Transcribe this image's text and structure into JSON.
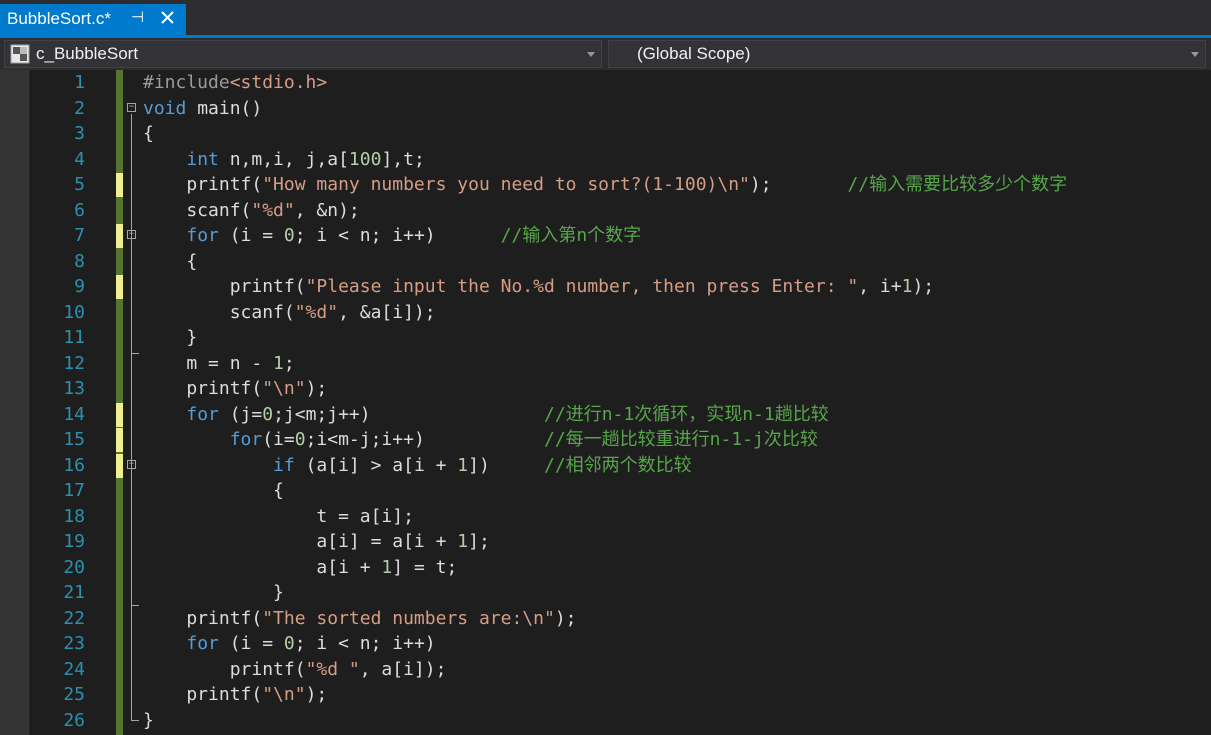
{
  "tab": {
    "title": "BubbleSort.c*"
  },
  "navbar": {
    "project": "c_BubbleSort",
    "scope": "(Global Scope)"
  },
  "colors": {
    "accent": "#007acc",
    "keyword": "#569cd6",
    "string": "#d69d85",
    "comment": "#57a64a",
    "line_number": "#2b91af",
    "number": "#b5cea8"
  },
  "icons": {
    "pin": "pin-icon",
    "close": "close-icon",
    "project": "c-project-icon"
  },
  "code": {
    "lines": [
      {
        "n": "1",
        "mod": false,
        "fold": null,
        "segs": [
          {
            "t": "#include",
            "c": "pp"
          },
          {
            "t": "<stdio.h>",
            "c": "str"
          }
        ]
      },
      {
        "n": "2",
        "mod": false,
        "fold": "open",
        "segs": [
          {
            "t": "void",
            "c": "kw"
          },
          {
            "t": " main()",
            "c": ""
          }
        ]
      },
      {
        "n": "3",
        "mod": false,
        "fold": null,
        "segs": [
          {
            "t": "{",
            "c": ""
          }
        ]
      },
      {
        "n": "4",
        "mod": false,
        "fold": null,
        "segs": [
          {
            "t": "    ",
            "c": ""
          },
          {
            "t": "int",
            "c": "kw"
          },
          {
            "t": " n,m,i, j,a[",
            "c": ""
          },
          {
            "t": "100",
            "c": "num"
          },
          {
            "t": "],t;",
            "c": ""
          }
        ]
      },
      {
        "n": "5",
        "mod": true,
        "fold": null,
        "segs": [
          {
            "t": "    printf(",
            "c": ""
          },
          {
            "t": "\"How many numbers you need to sort?(1-100)\\n\"",
            "c": "str"
          },
          {
            "t": ");       ",
            "c": ""
          },
          {
            "t": "//输入需要比较多少个数字",
            "c": "cm"
          }
        ]
      },
      {
        "n": "6",
        "mod": false,
        "fold": null,
        "segs": [
          {
            "t": "    scanf(",
            "c": ""
          },
          {
            "t": "\"%d\"",
            "c": "str"
          },
          {
            "t": ", &n);",
            "c": ""
          }
        ]
      },
      {
        "n": "7",
        "mod": true,
        "fold": "open",
        "segs": [
          {
            "t": "    ",
            "c": ""
          },
          {
            "t": "for",
            "c": "kw"
          },
          {
            "t": " (i = ",
            "c": ""
          },
          {
            "t": "0",
            "c": "num"
          },
          {
            "t": "; i < n; i++)      ",
            "c": ""
          },
          {
            "t": "//输入第n个数字",
            "c": "cm"
          }
        ]
      },
      {
        "n": "8",
        "mod": false,
        "fold": null,
        "segs": [
          {
            "t": "    {",
            "c": ""
          }
        ]
      },
      {
        "n": "9",
        "mod": true,
        "fold": null,
        "segs": [
          {
            "t": "        printf(",
            "c": ""
          },
          {
            "t": "\"Please input the No.%d number, then press Enter: \"",
            "c": "str"
          },
          {
            "t": ", i+",
            "c": ""
          },
          {
            "t": "1",
            "c": "num"
          },
          {
            "t": ");",
            "c": ""
          }
        ]
      },
      {
        "n": "10",
        "mod": false,
        "fold": null,
        "segs": [
          {
            "t": "        scanf(",
            "c": ""
          },
          {
            "t": "\"%d\"",
            "c": "str"
          },
          {
            "t": ", &a[i]);",
            "c": ""
          }
        ]
      },
      {
        "n": "11",
        "mod": false,
        "fold": null,
        "segs": [
          {
            "t": "    }",
            "c": ""
          }
        ]
      },
      {
        "n": "12",
        "mod": false,
        "fold": null,
        "segs": [
          {
            "t": "    m = n - ",
            "c": ""
          },
          {
            "t": "1",
            "c": "num"
          },
          {
            "t": ";",
            "c": ""
          }
        ]
      },
      {
        "n": "13",
        "mod": false,
        "fold": null,
        "segs": [
          {
            "t": "    printf(",
            "c": ""
          },
          {
            "t": "\"\\n\"",
            "c": "str"
          },
          {
            "t": ");",
            "c": ""
          }
        ]
      },
      {
        "n": "14",
        "mod": true,
        "fold": null,
        "segs": [
          {
            "t": "    ",
            "c": ""
          },
          {
            "t": "for",
            "c": "kw"
          },
          {
            "t": " (j=",
            "c": ""
          },
          {
            "t": "0",
            "c": "num"
          },
          {
            "t": ";j<m;j++)                ",
            "c": ""
          },
          {
            "t": "//进行n-1次循环，实现n-1趟比较",
            "c": "cm"
          }
        ]
      },
      {
        "n": "15",
        "mod": true,
        "fold": null,
        "segs": [
          {
            "t": "        ",
            "c": ""
          },
          {
            "t": "for",
            "c": "kw"
          },
          {
            "t": "(i=",
            "c": ""
          },
          {
            "t": "0",
            "c": "num"
          },
          {
            "t": ";i<m-j;i++)           ",
            "c": ""
          },
          {
            "t": "//每一趟比较重进行n-1-j次比较",
            "c": "cm"
          }
        ]
      },
      {
        "n": "16",
        "mod": true,
        "fold": "open",
        "segs": [
          {
            "t": "            ",
            "c": ""
          },
          {
            "t": "if",
            "c": "kw"
          },
          {
            "t": " (a[i] > a[i + ",
            "c": ""
          },
          {
            "t": "1",
            "c": "num"
          },
          {
            "t": "])     ",
            "c": ""
          },
          {
            "t": "//相邻两个数比较",
            "c": "cm"
          }
        ]
      },
      {
        "n": "17",
        "mod": false,
        "fold": null,
        "segs": [
          {
            "t": "            {",
            "c": ""
          }
        ]
      },
      {
        "n": "18",
        "mod": false,
        "fold": null,
        "segs": [
          {
            "t": "                t = a[i];",
            "c": ""
          }
        ]
      },
      {
        "n": "19",
        "mod": false,
        "fold": null,
        "segs": [
          {
            "t": "                a[i] = a[i + ",
            "c": ""
          },
          {
            "t": "1",
            "c": "num"
          },
          {
            "t": "];",
            "c": ""
          }
        ]
      },
      {
        "n": "20",
        "mod": false,
        "fold": null,
        "segs": [
          {
            "t": "                a[i + ",
            "c": ""
          },
          {
            "t": "1",
            "c": "num"
          },
          {
            "t": "] = t;",
            "c": ""
          }
        ]
      },
      {
        "n": "21",
        "mod": false,
        "fold": null,
        "segs": [
          {
            "t": "            }",
            "c": ""
          }
        ]
      },
      {
        "n": "22",
        "mod": false,
        "fold": null,
        "segs": [
          {
            "t": "    printf(",
            "c": ""
          },
          {
            "t": "\"The sorted numbers are:\\n\"",
            "c": "str"
          },
          {
            "t": ");",
            "c": ""
          }
        ]
      },
      {
        "n": "23",
        "mod": false,
        "fold": null,
        "segs": [
          {
            "t": "    ",
            "c": ""
          },
          {
            "t": "for",
            "c": "kw"
          },
          {
            "t": " (i = ",
            "c": ""
          },
          {
            "t": "0",
            "c": "num"
          },
          {
            "t": "; i < n; i++)",
            "c": ""
          }
        ]
      },
      {
        "n": "24",
        "mod": false,
        "fold": null,
        "segs": [
          {
            "t": "        printf(",
            "c": ""
          },
          {
            "t": "\"%d \"",
            "c": "str"
          },
          {
            "t": ", a[i]);",
            "c": ""
          }
        ]
      },
      {
        "n": "25",
        "mod": false,
        "fold": null,
        "segs": [
          {
            "t": "    printf(",
            "c": ""
          },
          {
            "t": "\"\\n\"",
            "c": "str"
          },
          {
            "t": ");",
            "c": ""
          }
        ]
      },
      {
        "n": "26",
        "mod": false,
        "fold": null,
        "segs": [
          {
            "t": "}",
            "c": ""
          }
        ]
      }
    ]
  }
}
